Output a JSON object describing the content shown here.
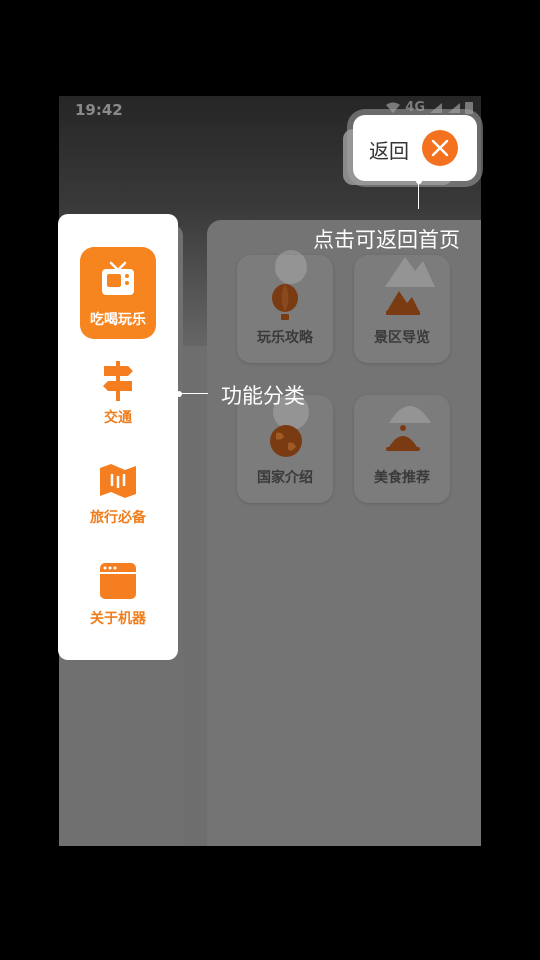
{
  "status_bar": {
    "time": "19:42",
    "network": "4G"
  },
  "side_menu": {
    "items": [
      {
        "label": "吃喝玩乐",
        "icon": "tv-icon",
        "active": true
      },
      {
        "label": "交通",
        "icon": "signpost-icon",
        "active": false
      },
      {
        "label": "旅行必备",
        "icon": "map-icon",
        "active": false
      },
      {
        "label": "关于机器",
        "icon": "browser-window-icon",
        "active": false
      }
    ]
  },
  "tiles": [
    {
      "label": "玩乐攻略",
      "icon": "hot-air-balloon-icon"
    },
    {
      "label": "景区导览",
      "icon": "mountain-icon"
    },
    {
      "label": "国家介绍",
      "icon": "globe-icon"
    },
    {
      "label": "美食推荐",
      "icon": "food-cloche-icon"
    }
  ],
  "back_button": {
    "label": "返回",
    "icon": "close-icon"
  },
  "annotations": {
    "back_hint": "点击可返回首页",
    "category_hint": "功能分类"
  },
  "colors": {
    "accent": "#f7851f",
    "close": "#f4711f"
  }
}
